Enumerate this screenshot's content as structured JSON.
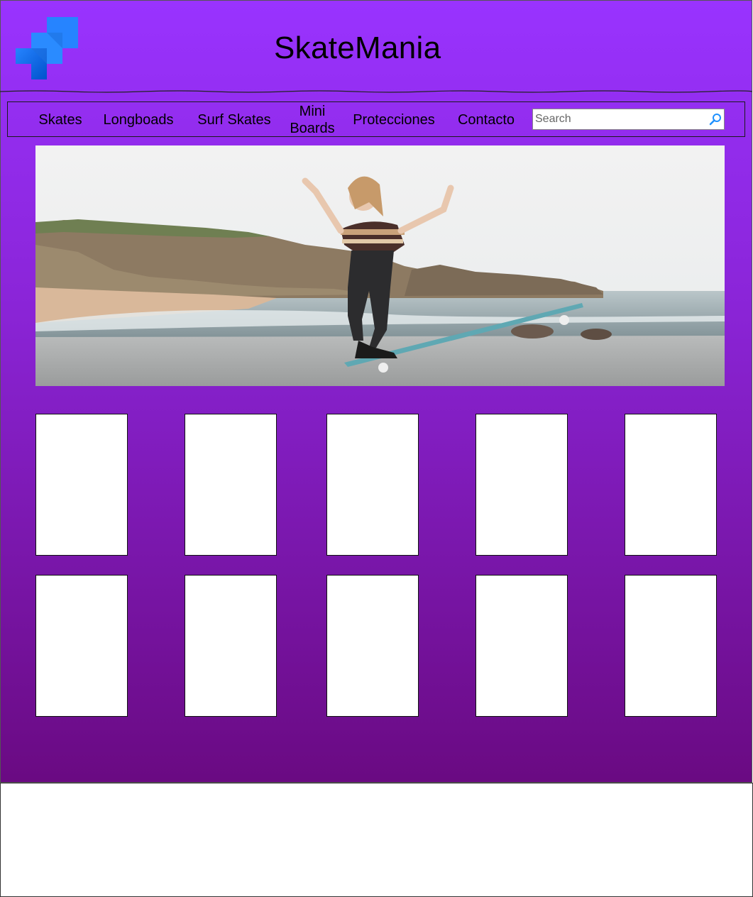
{
  "site": {
    "title": "SkateMania",
    "logo": "jira-style-logo"
  },
  "nav": {
    "items": [
      {
        "label": "Skates"
      },
      {
        "label": "Longboads"
      },
      {
        "label": "Surf Skates"
      },
      {
        "label_line1": "Mini",
        "label_line2": "Boards"
      },
      {
        "label": "Protecciones"
      },
      {
        "label": "Contacto"
      }
    ]
  },
  "search": {
    "placeholder": "Search",
    "value": "",
    "icon": "search-icon"
  },
  "hero": {
    "image": "skater-on-longboard-beach-photo"
  },
  "products": {
    "rows": 2,
    "per_row": 5
  },
  "colors": {
    "header_purple": "#9933ff",
    "bottom_purple": "#6a0a82",
    "card": "#ffffff",
    "search_icon": "#1e90ff"
  }
}
